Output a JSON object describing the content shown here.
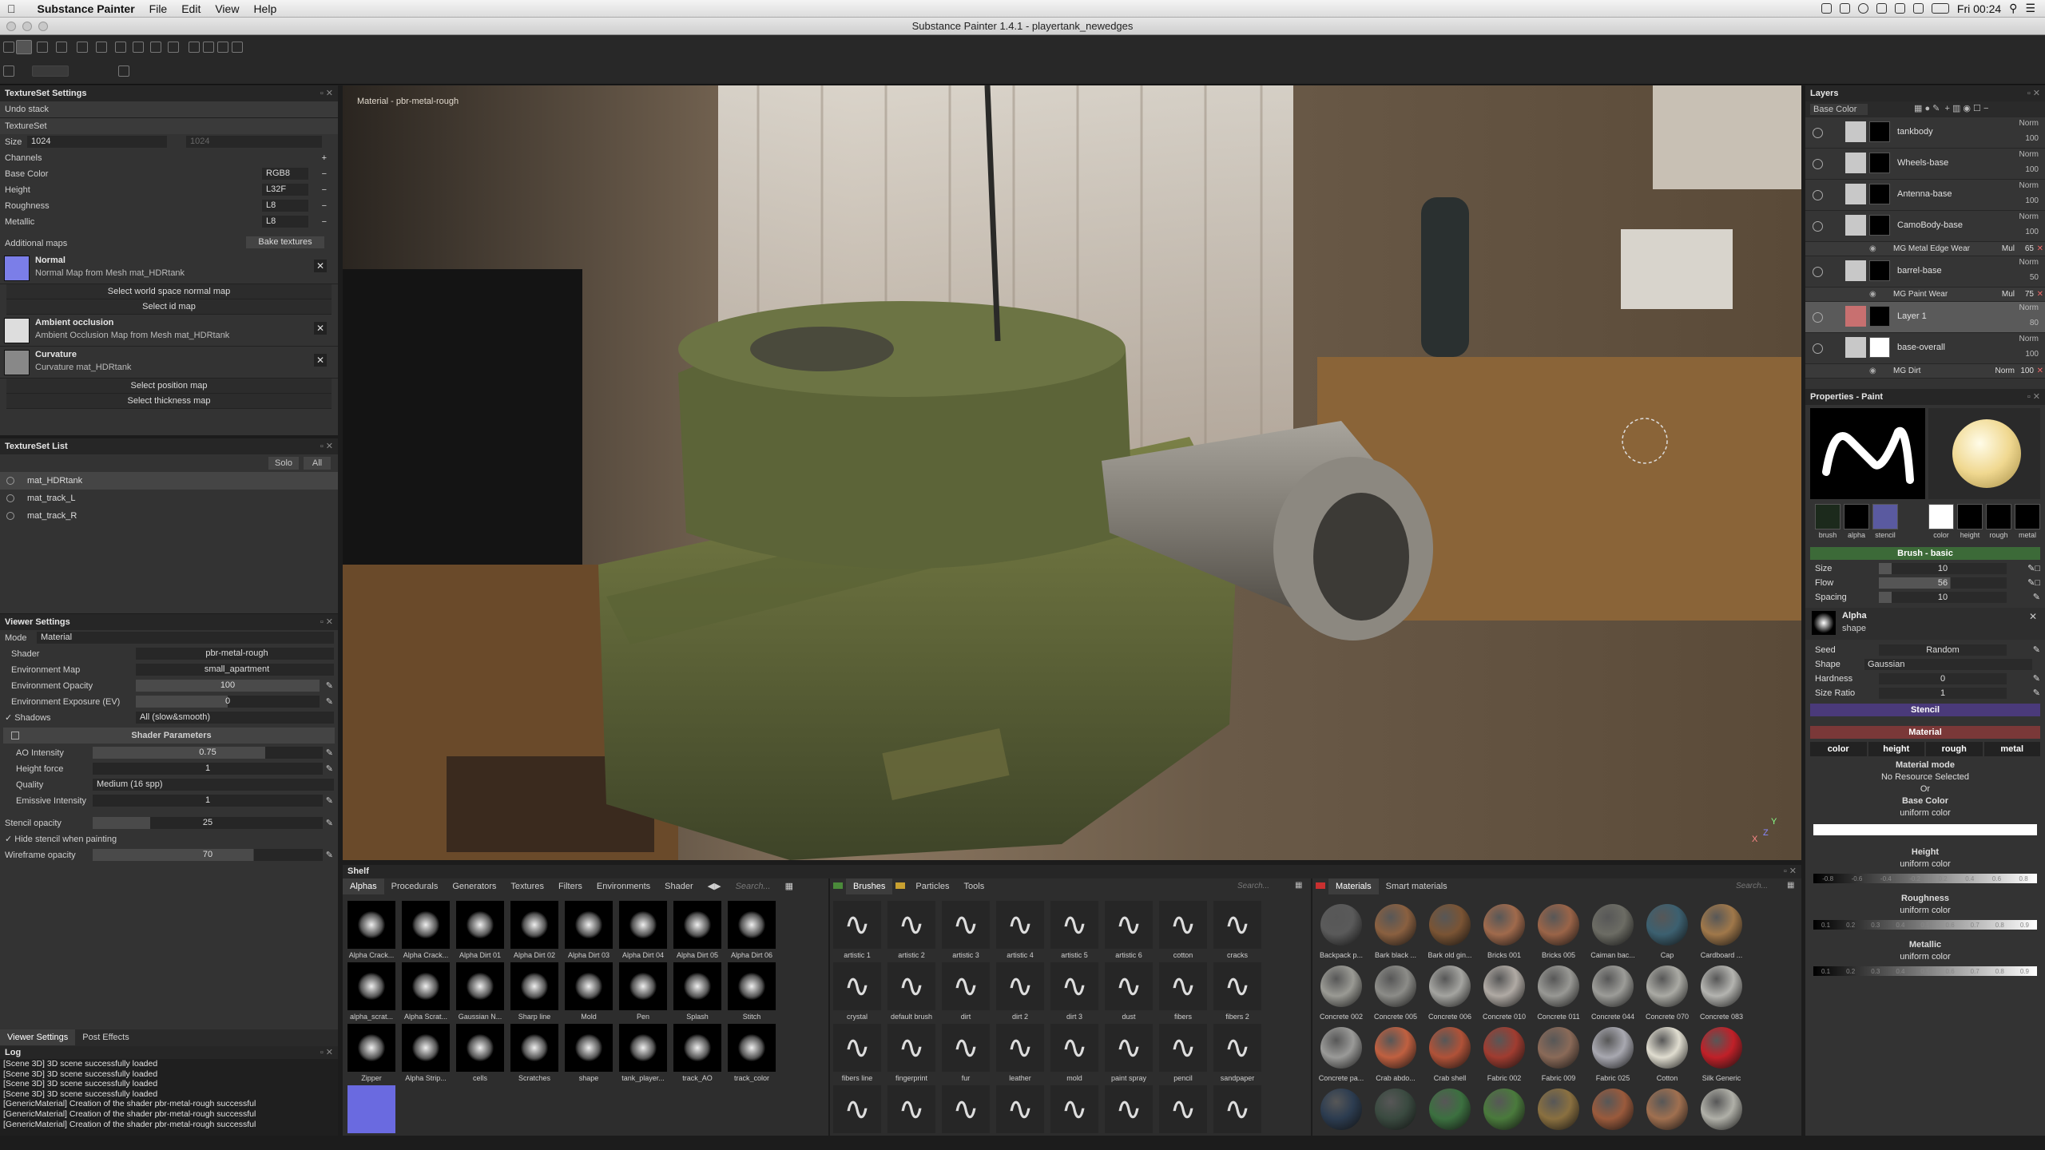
{
  "menubar": {
    "app": "Substance Painter",
    "items": [
      "File",
      "Edit",
      "View",
      "Help"
    ],
    "clock": "Fri 00:24"
  },
  "window": {
    "title": "Substance Painter 1.4.1 - playertank_newedges"
  },
  "textureset_settings": {
    "title": "TextureSet Settings",
    "undo": "Undo stack",
    "textureset": "TextureSet",
    "size_label": "Size",
    "size_value": "1024",
    "size_value2": "1024",
    "channels_label": "Channels",
    "channels": [
      {
        "name": "Base Color",
        "format": "RGB8"
      },
      {
        "name": "Height",
        "format": "L32F"
      },
      {
        "name": "Roughness",
        "format": "L8"
      },
      {
        "name": "Metallic",
        "format": "L8"
      }
    ],
    "additional_maps": "Additional maps",
    "bake": "Bake textures",
    "normal": {
      "title": "Normal",
      "sub": "Normal Map from Mesh mat_HDRtank"
    },
    "select_world": "Select world space normal map",
    "select_id": "Select id map",
    "ao": {
      "title": "Ambient occlusion",
      "sub": "Ambient Occlusion Map from Mesh mat_HDRtank"
    },
    "curvature": {
      "title": "Curvature",
      "sub": "Curvature mat_HDRtank"
    },
    "select_position": "Select position map",
    "select_thickness": "Select thickness map"
  },
  "textureset_list": {
    "title": "TextureSet List",
    "solo": "Solo",
    "all": "All",
    "items": [
      "mat_HDRtank",
      "mat_track_L",
      "mat_track_R"
    ]
  },
  "viewer_settings": {
    "title": "Viewer Settings",
    "mode_label": "Mode",
    "mode": "Material",
    "shader_label": "Shader",
    "shader": "pbr-metal-rough",
    "envmap_label": "Environment Map",
    "envmap": "small_apartment",
    "envop_label": "Environment Opacity",
    "envop": "100",
    "envexp_label": "Environment Exposure (EV)",
    "envexp": "0",
    "shadows_label": "Shadows",
    "shadows": "All (slow&smooth)",
    "shader_params": "Shader Parameters",
    "ao_label": "AO Intensity",
    "ao": "0.75",
    "ao_level": 0.75,
    "hf_label": "Height force",
    "hf": "1",
    "quality_label": "Quality",
    "quality": "Medium (16 spp)",
    "emis_label": "Emissive Intensity",
    "emis": "1",
    "stencil_label": "Stencil opacity",
    "stencil": "25",
    "stencil_level": 0.25,
    "hide_stencil": "Hide stencil when painting",
    "wire_label": "Wireframe opacity",
    "wire": "70",
    "wire_level": 0.7,
    "tab1": "Viewer Settings",
    "tab2": "Post Effects"
  },
  "log": {
    "title": "Log",
    "lines": [
      "[Scene 3D] 3D scene successfully loaded",
      "[Scene 3D] 3D scene successfully loaded",
      "[Scene 3D] 3D scene successfully loaded",
      "[Scene 3D] 3D scene successfully loaded",
      "[GenericMaterial] Creation of the shader pbr-metal-rough successful",
      "[GenericMaterial] Creation of the shader pbr-metal-rough successful",
      "[GenericMaterial] Creation of the shader pbr-metal-rough successful"
    ]
  },
  "viewport": {
    "label": "Material - pbr-metal-rough",
    "axis_x": "X",
    "axis_y": "Y",
    "axis_z": "Z"
  },
  "shelf": {
    "title": "Shelf",
    "tabs": [
      "Alphas",
      "Procedurals",
      "Generators",
      "Textures",
      "Filters",
      "Environments",
      "Shader"
    ],
    "search": "Search...",
    "alphas": [
      "Alpha Crack...",
      "Alpha Crack...",
      "Alpha Dirt 01",
      "Alpha Dirt 02",
      "Alpha Dirt 03",
      "Alpha Dirt 04",
      "Alpha Dirt 05",
      "Alpha Dirt 06",
      "alpha_scrat...",
      "Alpha Scrat...",
      "Gaussian N...",
      "Sharp line",
      "Mold",
      "Pen",
      "Splash",
      "Stitch",
      "Zipper",
      "Alpha Strip...",
      "cells",
      "Scratches",
      "shape",
      "tank_player...",
      "track_AO",
      "track_color",
      ""
    ],
    "brush_tabs": [
      "Brushes",
      "Particles",
      "Tools"
    ],
    "brushes": [
      "artistic 1",
      "artistic 2",
      "artistic 3",
      "artistic 4",
      "artistic 5",
      "artistic 6",
      "cotton",
      "cracks",
      "crystal",
      "default brush",
      "dirt",
      "dirt 2",
      "dirt 3",
      "dust",
      "fibers",
      "fibers 2",
      "fibers line",
      "fingerprint",
      "fur",
      "leather",
      "mold",
      "paint spray",
      "pencil",
      "sandpaper",
      "",
      "",
      "",
      "",
      "",
      "",
      "",
      ""
    ],
    "mat_tabs": [
      "Materials",
      "Smart materials"
    ],
    "materials": [
      {
        "name": "Backpack p...",
        "color": "#5a5a5a"
      },
      {
        "name": "Bark black ...",
        "color": "#8a6040"
      },
      {
        "name": "Bark old gin...",
        "color": "#7a5434"
      },
      {
        "name": "Bricks 001",
        "color": "#a06a4c"
      },
      {
        "name": "Bricks 005",
        "color": "#9a6448"
      },
      {
        "name": "Caiman bac...",
        "color": "#6c6c64"
      },
      {
        "name": "Cap",
        "color": "#3c6070"
      },
      {
        "name": "Cardboard ...",
        "color": "#a0784a"
      },
      {
        "name": "Concrete 002",
        "color": "#9a9a94"
      },
      {
        "name": "Concrete 005",
        "color": "#8c8c88"
      },
      {
        "name": "Concrete 006",
        "color": "#a4a4a0"
      },
      {
        "name": "Concrete 010",
        "color": "#b0aaa4"
      },
      {
        "name": "Concrete 011",
        "color": "#989894"
      },
      {
        "name": "Concrete 044",
        "color": "#9c9c98"
      },
      {
        "name": "Concrete 070",
        "color": "#aaaaa4"
      },
      {
        "name": "Concrete 083",
        "color": "#b4b4b0"
      },
      {
        "name": "Concrete pa...",
        "color": "#9a9a98"
      },
      {
        "name": "Crab abdo...",
        "color": "#c06040"
      },
      {
        "name": "Crab shell",
        "color": "#b05238"
      },
      {
        "name": "Fabric 002",
        "color": "#a03c30"
      },
      {
        "name": "Fabric 009",
        "color": "#8a6a58"
      },
      {
        "name": "Fabric 025",
        "color": "#a8a8b0"
      },
      {
        "name": "Cotton",
        "color": "#e0ddd0"
      },
      {
        "name": "Silk Generic",
        "color": "#c02028"
      },
      {
        "name": "",
        "color": "#2c3c50"
      },
      {
        "name": "",
        "color": "#3a4a40"
      },
      {
        "name": "",
        "color": "#3c7040"
      },
      {
        "name": "",
        "color": "#4a7a3c"
      },
      {
        "name": "",
        "color": "#8a7040"
      },
      {
        "name": "",
        "color": "#9a5a3c"
      },
      {
        "name": "",
        "color": "#a07050"
      },
      {
        "name": "",
        "color": "#b0b0a8"
      }
    ]
  },
  "layers": {
    "title": "Layers",
    "channel": "Base Color",
    "items": [
      {
        "name": "tankbody",
        "blend": "Norm",
        "opacity": "100"
      },
      {
        "name": "Wheels-base",
        "blend": "Norm",
        "opacity": "100"
      },
      {
        "name": "Antenna-base",
        "blend": "Norm",
        "opacity": "100"
      },
      {
        "name": "CamoBody-base",
        "blend": "Norm",
        "opacity": "100",
        "sub": {
          "name": "MG Metal Edge Wear",
          "blend": "Mul",
          "opacity": "65"
        }
      },
      {
        "name": "barrel-base",
        "blend": "Norm",
        "opacity": "50",
        "sub": {
          "name": "MG Paint Wear",
          "blend": "Mul",
          "opacity": "75"
        }
      },
      {
        "name": "Layer 1",
        "blend": "Norm",
        "opacity": "80"
      },
      {
        "name": "base-overall",
        "blend": "Norm",
        "opacity": "100",
        "sub": {
          "name": "MG Dirt",
          "blend": "Norm",
          "opacity": "100"
        }
      }
    ]
  },
  "properties": {
    "title": "Properties - Paint",
    "slots": [
      "brush",
      "alpha",
      "stencil",
      "color",
      "height",
      "rough",
      "metal"
    ],
    "brush_basic": "Brush - basic",
    "size_label": "Size",
    "size": "10",
    "size_level": 0.1,
    "flow_label": "Flow",
    "flow": "56",
    "flow_level": 0.56,
    "spacing_label": "Spacing",
    "spacing": "10",
    "spacing_level": 0.1,
    "alpha_title": "Alpha",
    "alpha_sub": "shape",
    "seed_label": "Seed",
    "seed": "Random",
    "shape_label": "Shape",
    "shape": "Gaussian",
    "hardness_label": "Hardness",
    "hardness": "0",
    "ratio_label": "Size Ratio",
    "ratio": "1",
    "stencil": "Stencil",
    "material": "Material",
    "mat_chips": [
      "color",
      "height",
      "rough",
      "metal"
    ],
    "mat_mode": "Material mode",
    "no_res": "No Resource Selected",
    "or": "Or",
    "base_color": "Base Color",
    "uniform": "uniform color",
    "height": "Height",
    "roughness": "Roughness",
    "metallic": "Metallic",
    "ticks": [
      "0.1",
      "0.2",
      "0.3",
      "0.4",
      "0.5",
      "0.6",
      "0.7",
      "0.8",
      "0.9"
    ],
    "height_ticks": [
      "-0.8",
      "-0.6",
      "-0.4",
      "-0.2",
      "0.2",
      "0.4",
      "0.6",
      "0.8"
    ]
  }
}
